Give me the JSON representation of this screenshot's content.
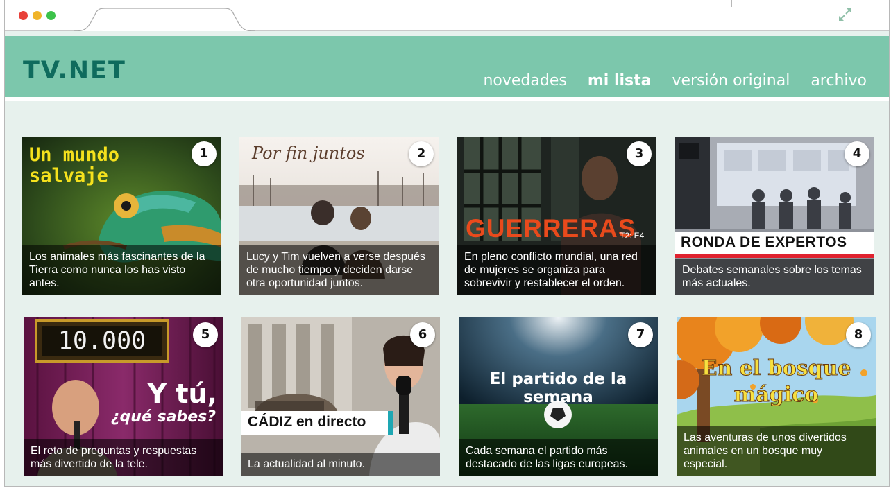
{
  "site": {
    "logo": "TV.NET"
  },
  "nav": [
    {
      "label": "novedades",
      "active": false
    },
    {
      "label": "mi lista",
      "active": true
    },
    {
      "label": "versión original",
      "active": false
    },
    {
      "label": "archivo",
      "active": false
    }
  ],
  "cards": [
    {
      "number": "1",
      "title": "Un mundo salvaje",
      "description": "Los animales más fascinantes de la Tierra como nunca los has visto antes."
    },
    {
      "number": "2",
      "title": "Por fin juntos",
      "description": "Lucy y Tim vuelven a verse después de mucho tiempo y deciden darse otra oportunidad juntos."
    },
    {
      "number": "3",
      "title": "GUERRERAS",
      "episode": "T2: E4",
      "description": "En pleno conflicto mundial, una red de mujeres se organiza para sobrevivir y restablecer el orden."
    },
    {
      "number": "4",
      "title": "RONDA DE EXPERTOS",
      "description": "Debates semanales sobre los temas más actuales."
    },
    {
      "number": "5",
      "sign": "10.000",
      "title_line1": "Y tú,",
      "title_line2": "¿qué sabes?",
      "description": "El reto de preguntas y respuestas más divertido de la tele."
    },
    {
      "number": "6",
      "title": "CÁDIZ en directo",
      "description": "La actualidad al minuto."
    },
    {
      "number": "7",
      "title": "El partido de la semana",
      "description": "Cada semana el partido más destacado de las ligas europeas."
    },
    {
      "number": "8",
      "title_line1": "En el bosque",
      "title_line2": "mágico",
      "description": "Las aventuras de unos divertidos animales en un bosque muy especial."
    }
  ],
  "colors": {
    "header": "#7cc7ac",
    "logo": "#0f6b5d",
    "page_bg": "#e7f1ed"
  }
}
